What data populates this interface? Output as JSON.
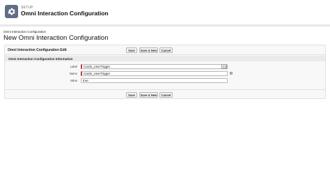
{
  "header": {
    "overline": "SETUP",
    "title": "Omni Interaction Configuration",
    "icon": "gear-icon"
  },
  "page": {
    "breadcrumb": "Omni Interaction Configuration",
    "title": "New Omni Interaction Configuration"
  },
  "edit_panel": {
    "heading": "Omni Interaction Configuration Edit",
    "buttons": {
      "save": "Save",
      "save_new": "Save & New",
      "cancel": "Cancel"
    },
    "section": {
      "title": "Omni Interaction Configuration Information",
      "fields": {
        "label": {
          "label": "Label",
          "value": "Cards_UserTrigger"
        },
        "name": {
          "label": "Name",
          "value": "Cards_UserTrigger"
        },
        "value": {
          "label": "Value",
          "value": "true"
        }
      }
    }
  },
  "colors": {
    "required_marker": "#c23934",
    "header_icon_bg": "#5f6d85",
    "band": "#e6e7ea"
  }
}
